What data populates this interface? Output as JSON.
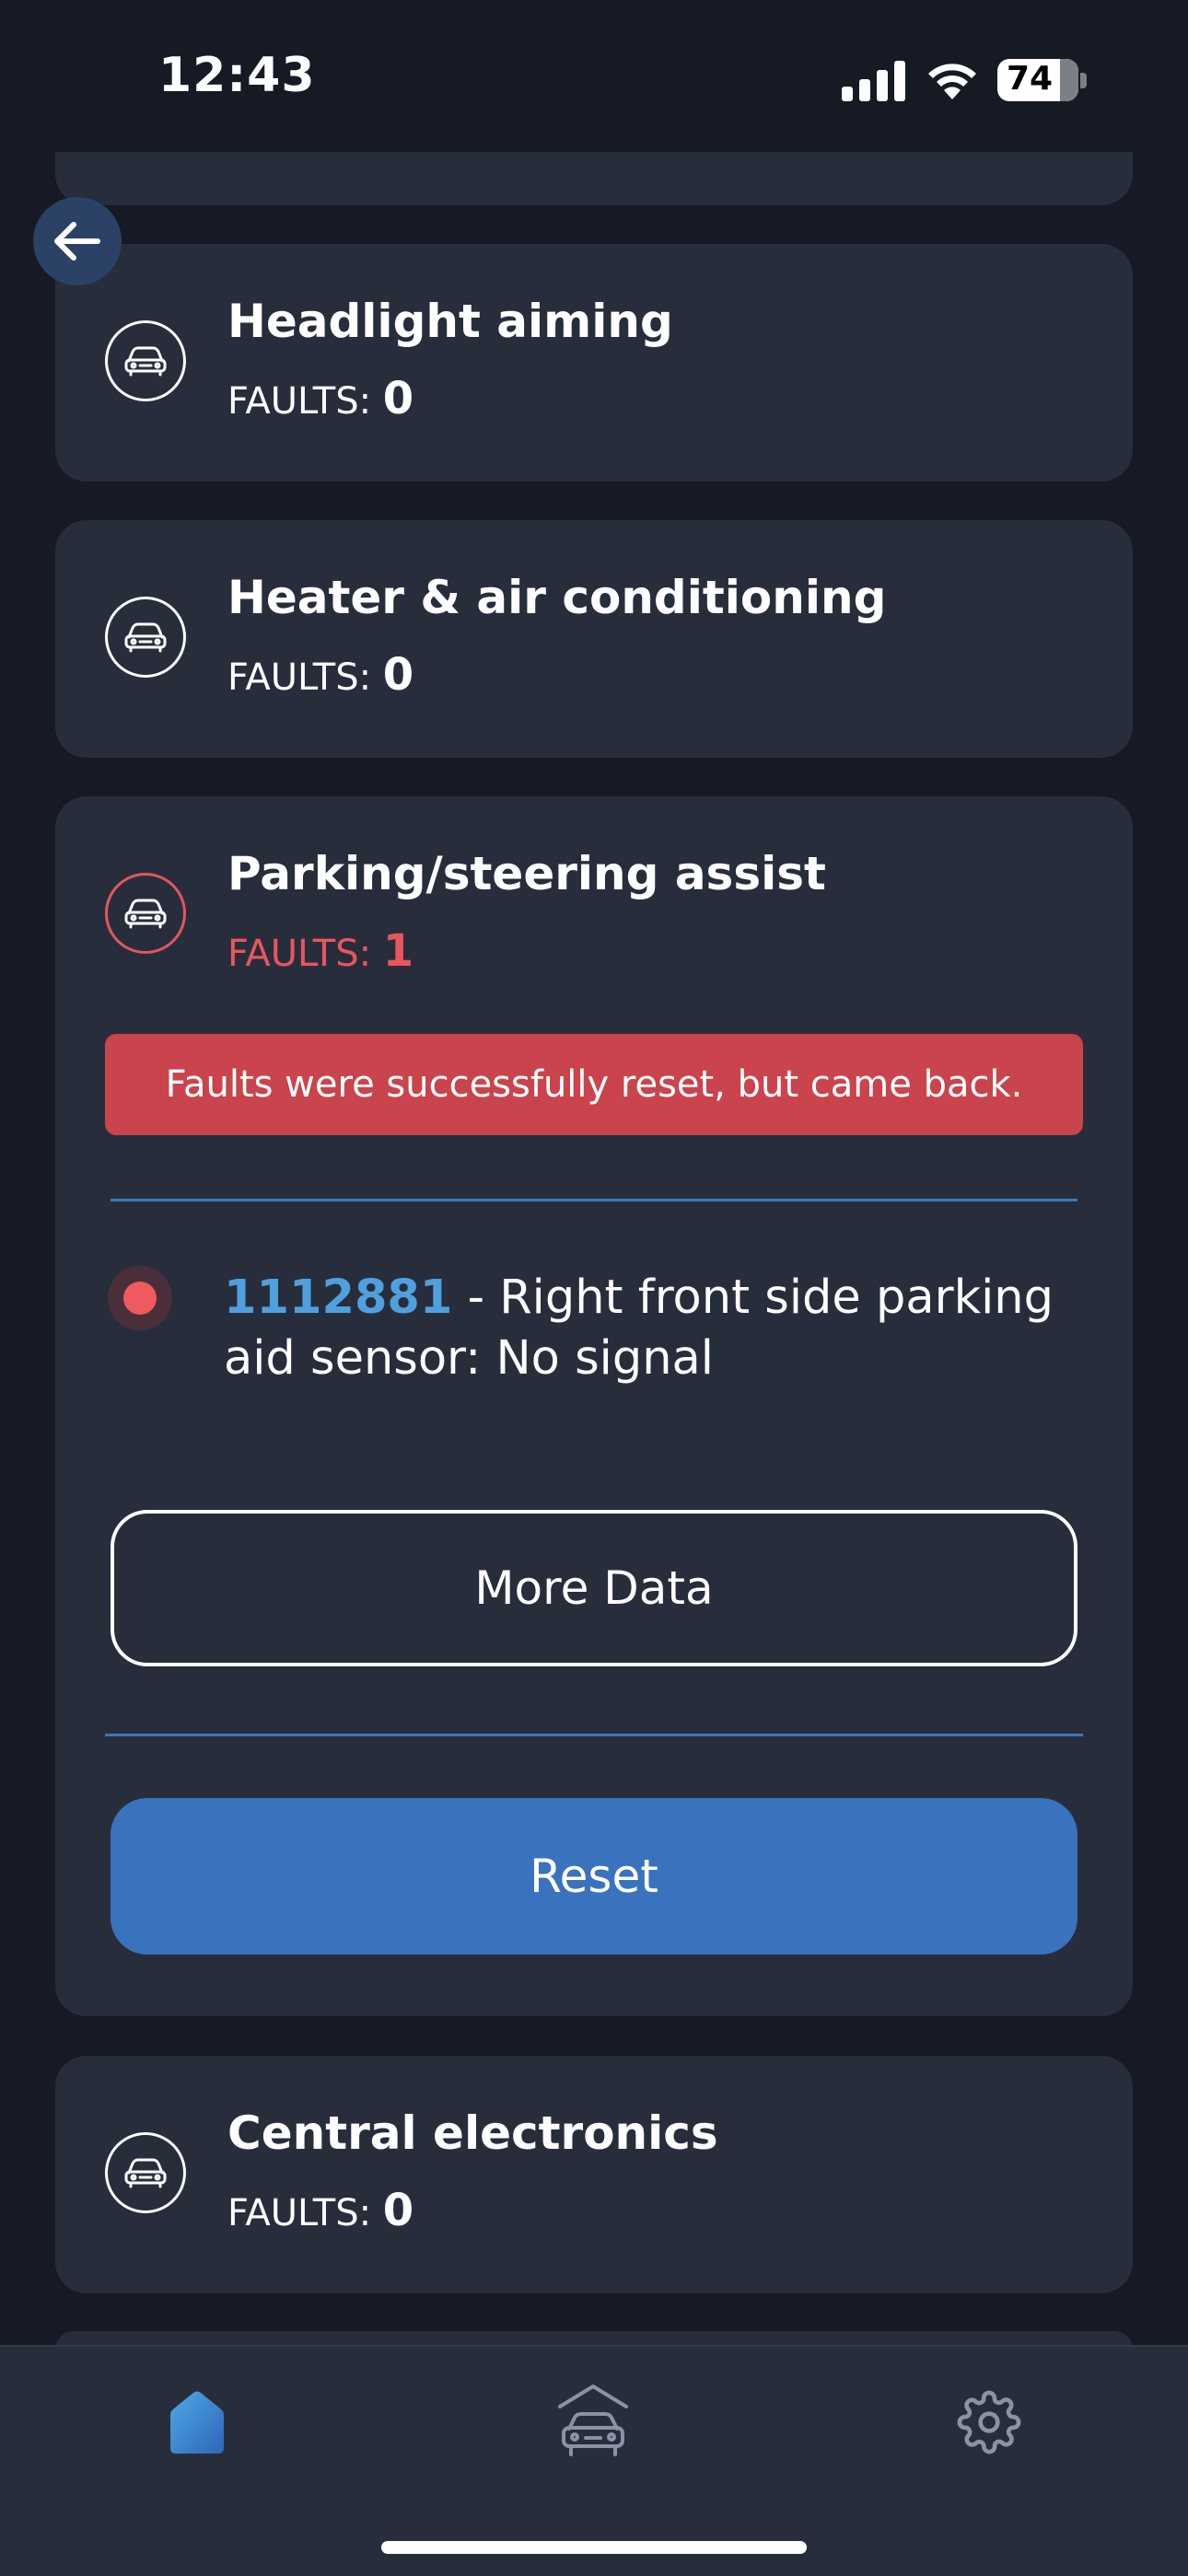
{
  "status_bar": {
    "time": "12:43",
    "battery": "74"
  },
  "cards": [
    {
      "title": "Headlight aiming",
      "faults_label": "FAULTS:",
      "faults_count": "0"
    },
    {
      "title": "Heater & air conditioning",
      "faults_label": "FAULTS:",
      "faults_count": "0"
    },
    {
      "title": "Parking/steering assist",
      "faults_label": "FAULTS:",
      "faults_count": "1",
      "alert": "Faults were successfully reset, but came back.",
      "fault": {
        "code": "1112881",
        "description": " - Right front side parking aid sensor: No signal"
      },
      "more_data_label": "More Data",
      "reset_label": "Reset"
    },
    {
      "title": "Central electronics",
      "faults_label": "FAULTS:",
      "faults_count": "0"
    }
  ],
  "tab_bar": {
    "tabs": [
      {
        "icon": "home-icon",
        "active": true
      },
      {
        "icon": "car-garage-icon",
        "active": false
      },
      {
        "icon": "gear-icon",
        "active": false
      }
    ]
  },
  "colors": {
    "background": "#161a25",
    "card": "#282d3c",
    "accent_blue": "#3a73bd",
    "fault_red": "#e9565d",
    "code_blue": "#4ea1dd"
  }
}
